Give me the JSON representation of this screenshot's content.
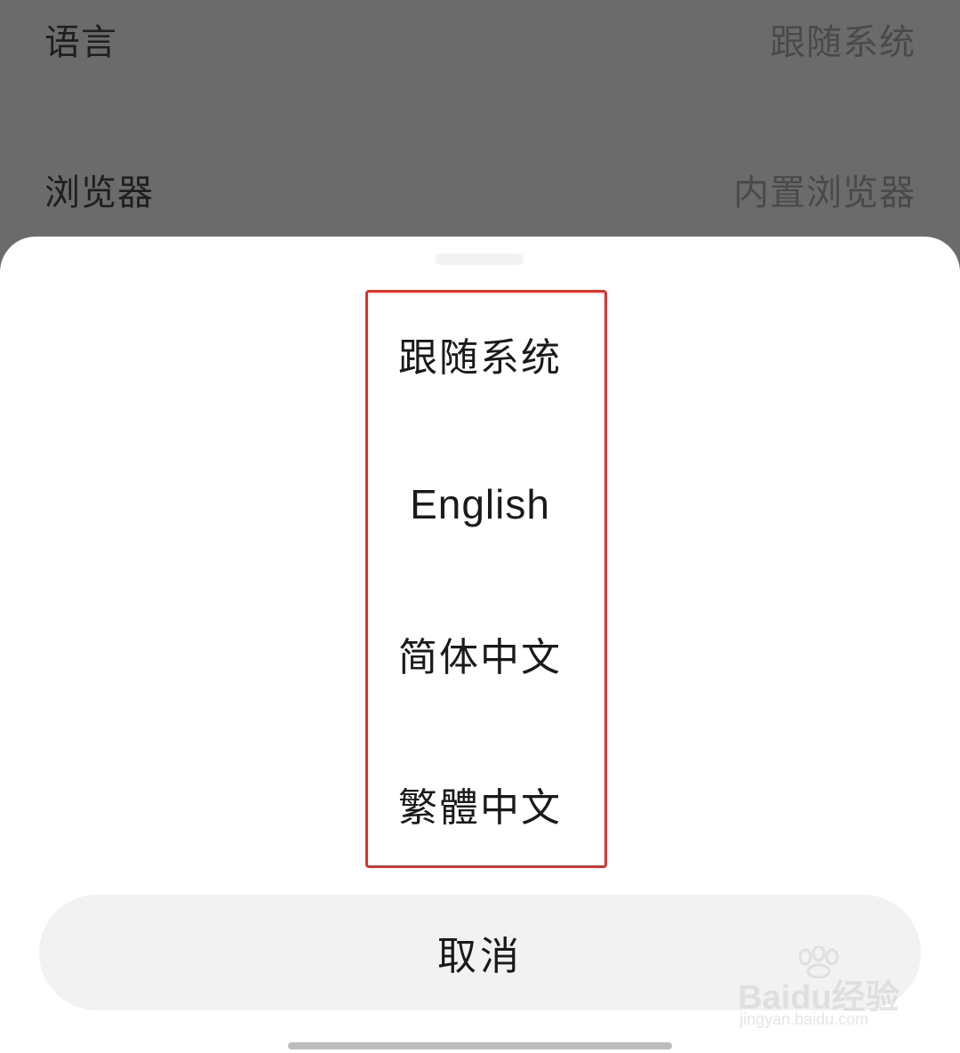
{
  "settings": {
    "rows": [
      {
        "label": "语言",
        "value": "跟随系统"
      },
      {
        "label": "浏览器",
        "value": "内置浏览器"
      }
    ]
  },
  "sheet": {
    "options": [
      {
        "label": "跟随系统"
      },
      {
        "label": "English"
      },
      {
        "label": "简体中文"
      },
      {
        "label": "繁體中文"
      }
    ],
    "cancel_label": "取消",
    "highlight_color": "#e0302a"
  },
  "watermark": {
    "brand": "Baidu经验",
    "url": "jingyan.baidu.com"
  },
  "colors": {
    "overlay": "#6b6b6b",
    "sheet": "#ffffff",
    "button": "#f2f2f2"
  }
}
